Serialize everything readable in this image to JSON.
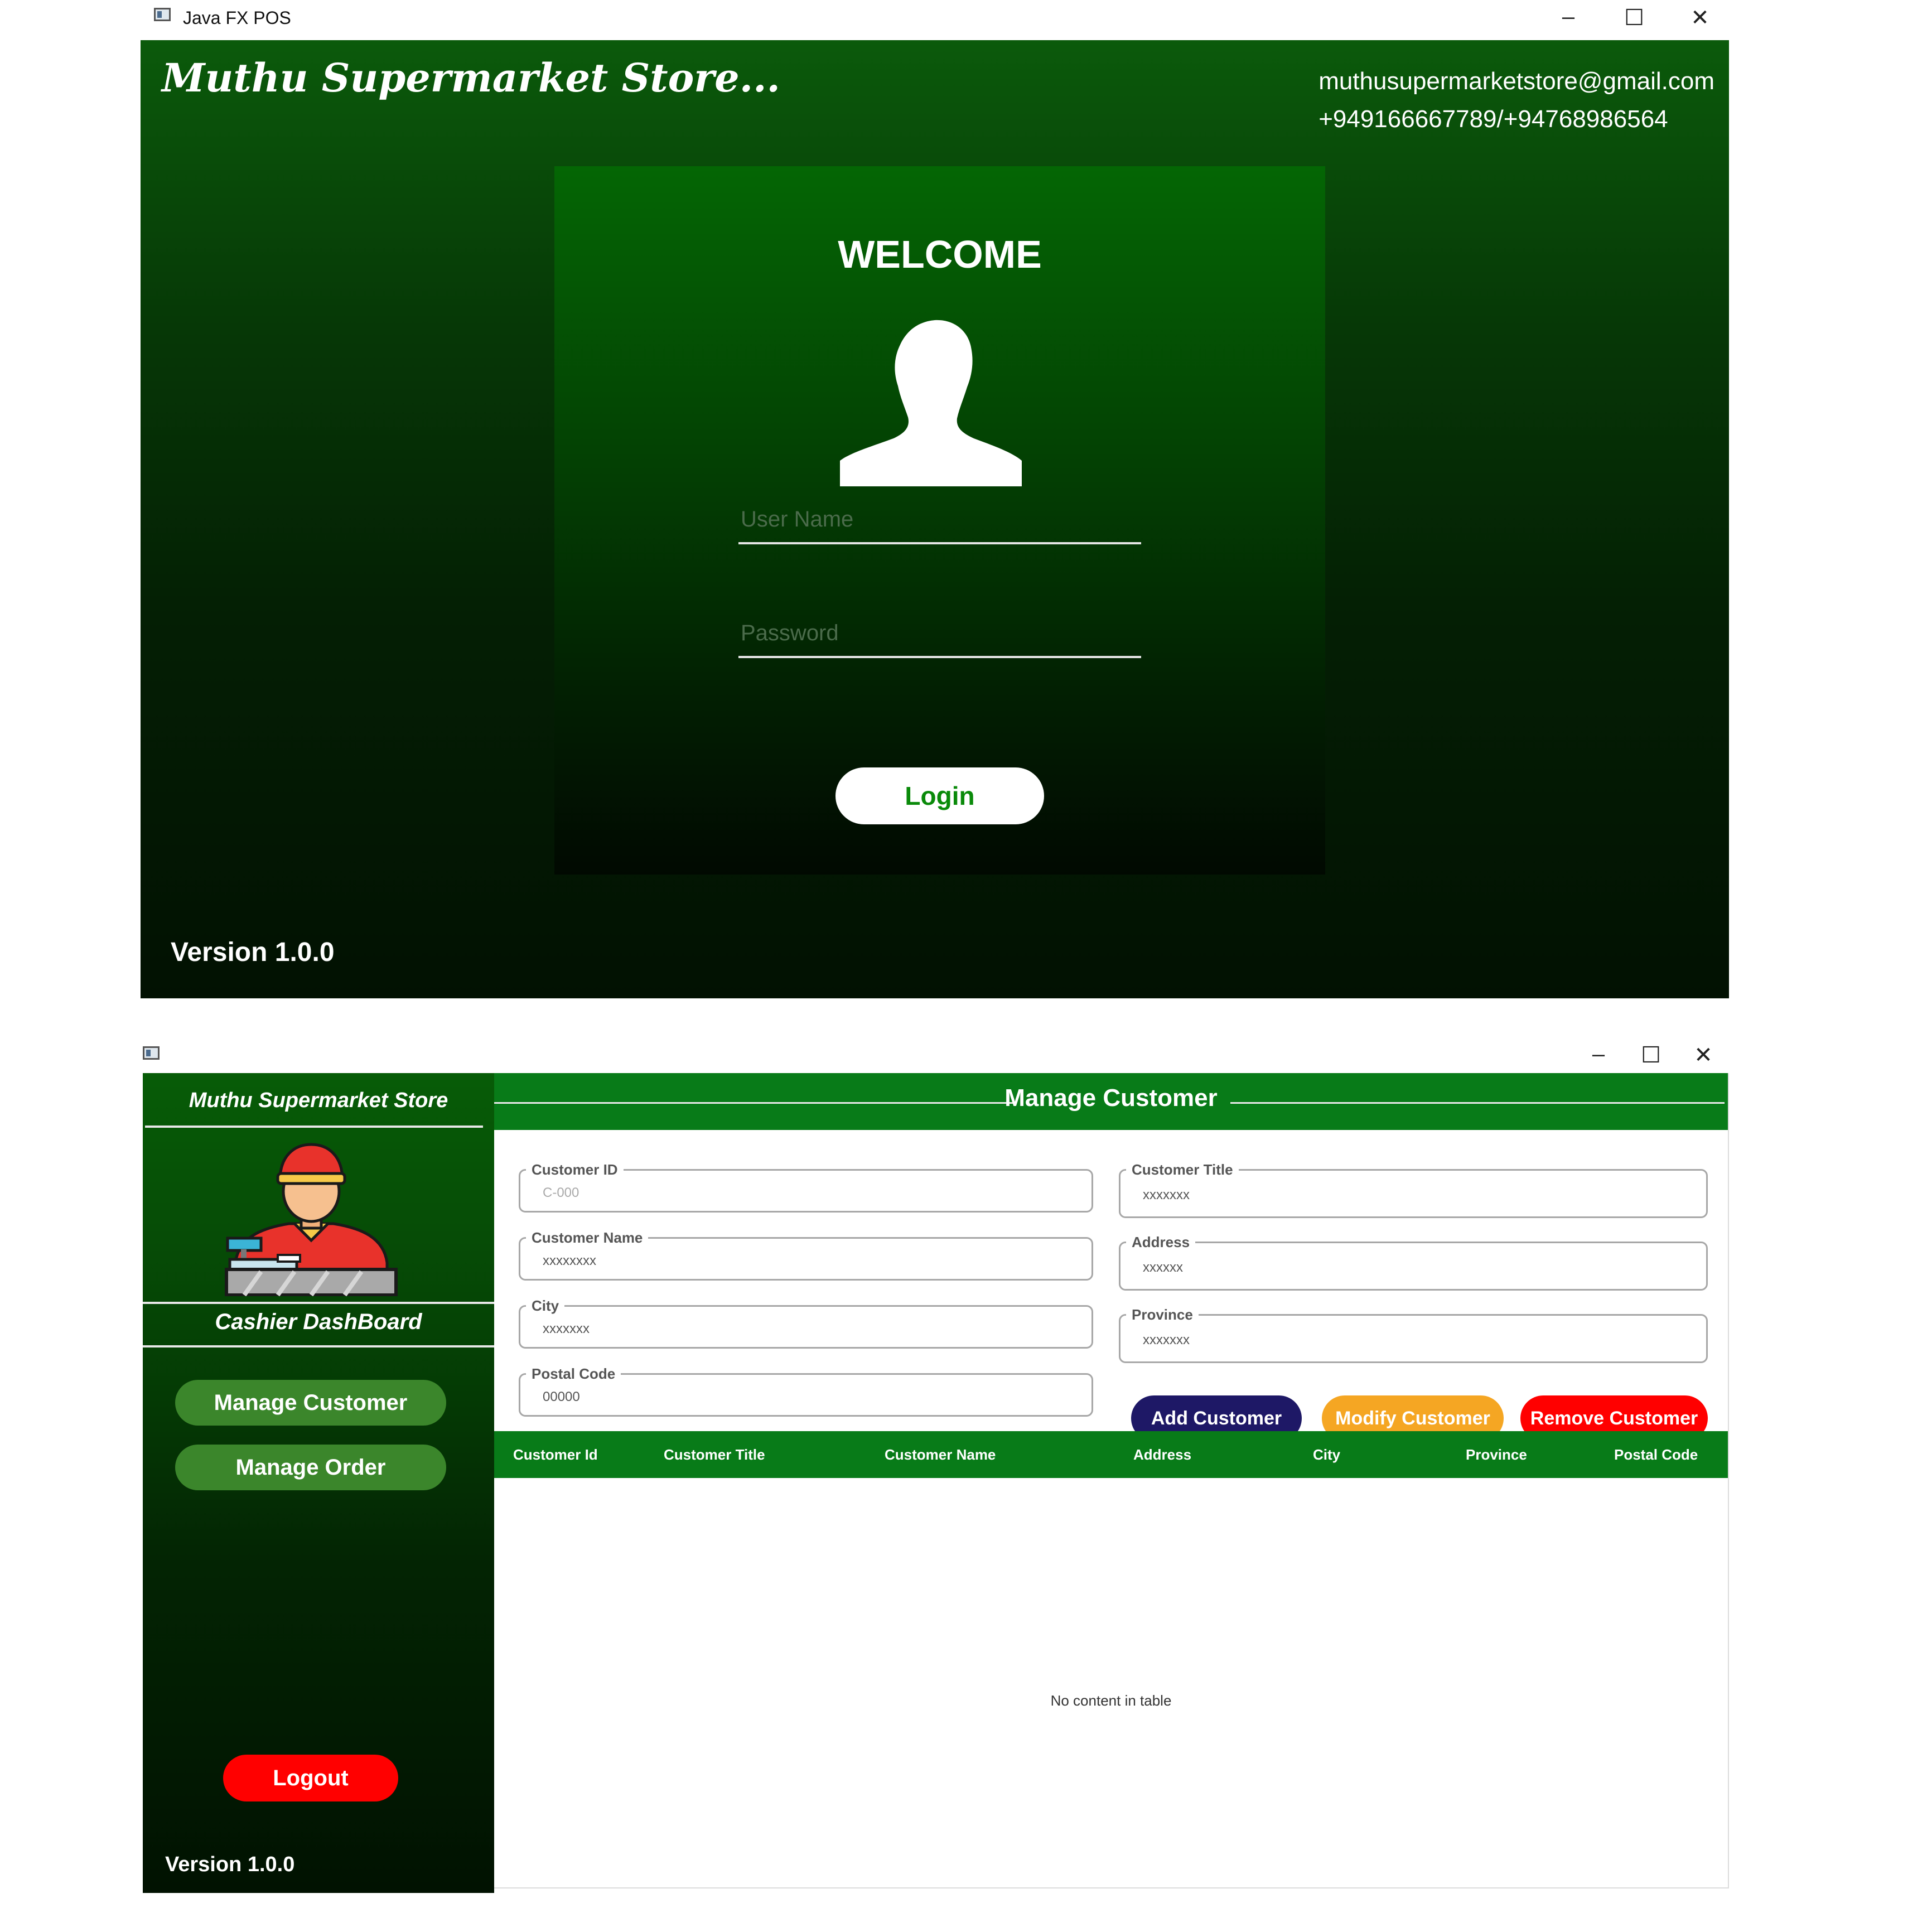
{
  "login_window": {
    "title_bar": {
      "title": "Java FX POS",
      "minimize": "–",
      "maximize": "☐",
      "close": "✕"
    },
    "store_title": "Muthu Supermarket Store...",
    "email": "muthusupermarketstore@gmail.com",
    "phone": "+949166667789/+94768986564",
    "welcome": "WELCOME",
    "username_placeholder": "User Name",
    "password_placeholder": "Password",
    "login_button": "Login",
    "version": "Version 1.0.0"
  },
  "dashboard_window": {
    "title_bar": {
      "minimize": "–",
      "maximize": "☐",
      "close": "✕"
    },
    "sidebar": {
      "store_name": "Muthu Supermarket Store",
      "dashboard_label": "Cashier DashBoard",
      "menu": [
        "Manage Customer",
        "Manage Order"
      ],
      "logout": "Logout",
      "version": "Version 1.0.0"
    },
    "header": "Manage Customer",
    "form": {
      "customer_id": {
        "label": "Customer ID",
        "placeholder": "C-000"
      },
      "customer_name": {
        "label": "Customer Name",
        "placeholder": "xxxxxxxx"
      },
      "city": {
        "label": "City",
        "placeholder": "xxxxxxx"
      },
      "postal_code": {
        "label": "Postal Code",
        "placeholder": "00000"
      },
      "customer_title": {
        "label": "Customer Title",
        "placeholder": "xxxxxxx"
      },
      "address": {
        "label": "Address",
        "placeholder": "xxxxxx"
      },
      "province": {
        "label": "Province",
        "placeholder": "xxxxxxx"
      }
    },
    "buttons": {
      "add": "Add Customer",
      "modify": "Modify Customer",
      "remove": "Remove Customer"
    },
    "table": {
      "columns": [
        "Customer Id",
        "Customer Title",
        "Customer Name",
        "Address",
        "City",
        "Province",
        "Postal Code"
      ],
      "empty_message": "No content in table"
    }
  },
  "colors": {
    "brand_green": "#087b18",
    "add_button": "#1e1866",
    "modify_button": "#f5a623",
    "remove_button": "#ff0000",
    "sidebar_button": "#3b862b"
  },
  "icons": [
    "window-icon",
    "user-avatar-icon",
    "cashier-icon"
  ]
}
